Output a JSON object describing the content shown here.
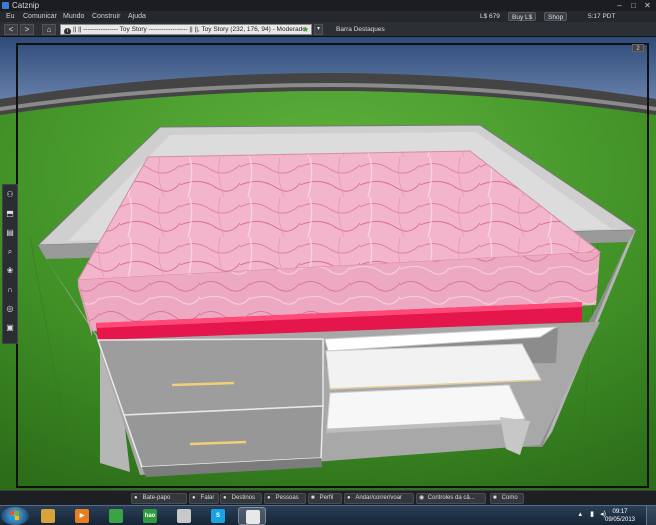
{
  "window": {
    "title": "Catznip",
    "minimize_glyph": "–",
    "maximize_glyph": "□",
    "close_glyph": "✕"
  },
  "menubar": {
    "items": [
      "Eu",
      "Comunicar",
      "Mundo",
      "Construir",
      "Ajuda"
    ],
    "balance": "L$ 679",
    "buy_label": "Buy L$",
    "shop_label": "Shop",
    "time": "5:17 PDT"
  },
  "navbar": {
    "back_glyph": "<",
    "forward_glyph": ">",
    "home_glyph": "⌂",
    "info_glyph": "i",
    "location": "|| ||  ---------------- Toy Story ------------------ || ||, Toy Story (232, 176, 94) - Moderado",
    "favorites_label": "Barra Destaques"
  },
  "viewport": {
    "corner_badge": "2"
  },
  "sidebar": {
    "items": [
      {
        "name": "people-icon",
        "glyph": "⚇"
      },
      {
        "name": "appearance-icon",
        "glyph": "⬒"
      },
      {
        "name": "inventory-icon",
        "glyph": "▤"
      },
      {
        "name": "search-icon",
        "glyph": "⌕"
      },
      {
        "name": "places-icon",
        "glyph": "❀"
      },
      {
        "name": "voice-icon",
        "glyph": "∩"
      },
      {
        "name": "radar-icon",
        "glyph": "◎"
      },
      {
        "name": "snapshot-icon",
        "glyph": "▣"
      }
    ]
  },
  "bottombar": {
    "items": [
      {
        "name": "chat-button",
        "icon": "chat-bubble-icon",
        "glyph": "●",
        "label": "Bate-papo"
      },
      {
        "name": "speak-button",
        "icon": "microphone-icon",
        "glyph": "●",
        "label": "Falar"
      },
      {
        "name": "destinations-button",
        "icon": "pin-icon",
        "glyph": "●",
        "label": "Destinos"
      },
      {
        "name": "people-button",
        "icon": "people-icon",
        "glyph": "●",
        "label": "Pessoas"
      },
      {
        "name": "profile-button",
        "icon": "profile-card-icon",
        "glyph": "■",
        "label": "Perfil"
      },
      {
        "name": "walk-fly-button",
        "icon": "walk-icon",
        "glyph": "●",
        "label": "Andar/correr/voar"
      },
      {
        "name": "camera-controls-button",
        "icon": "eye-icon",
        "glyph": "◉",
        "label": "Controles da câ..."
      },
      {
        "name": "how-to-button",
        "icon": "help-icon",
        "glyph": "■",
        "label": "Como"
      }
    ]
  },
  "taskbar": {
    "apps": [
      {
        "name": "explorer-taskbar-icon",
        "label": "",
        "color": "#d8a43a",
        "active": false
      },
      {
        "name": "media-player-taskbar-icon",
        "label": "▶",
        "color": "#e77f1f",
        "active": false
      },
      {
        "name": "chrome-taskbar-icon",
        "label": "",
        "color": "#3aa345",
        "active": false
      },
      {
        "name": "hao123-taskbar-icon",
        "label": "hao",
        "color": "#2d9b3e",
        "active": false
      },
      {
        "name": "photo-taskbar-icon",
        "label": "",
        "color": "#c8c8c8",
        "active": false
      },
      {
        "name": "skype-taskbar-icon",
        "label": "S",
        "color": "#1aa3e0",
        "active": false
      },
      {
        "name": "catznip-taskbar-icon",
        "label": "",
        "color": "#e8e8e8",
        "active": true
      }
    ],
    "time": "09:17",
    "date": "09/05/2013"
  }
}
